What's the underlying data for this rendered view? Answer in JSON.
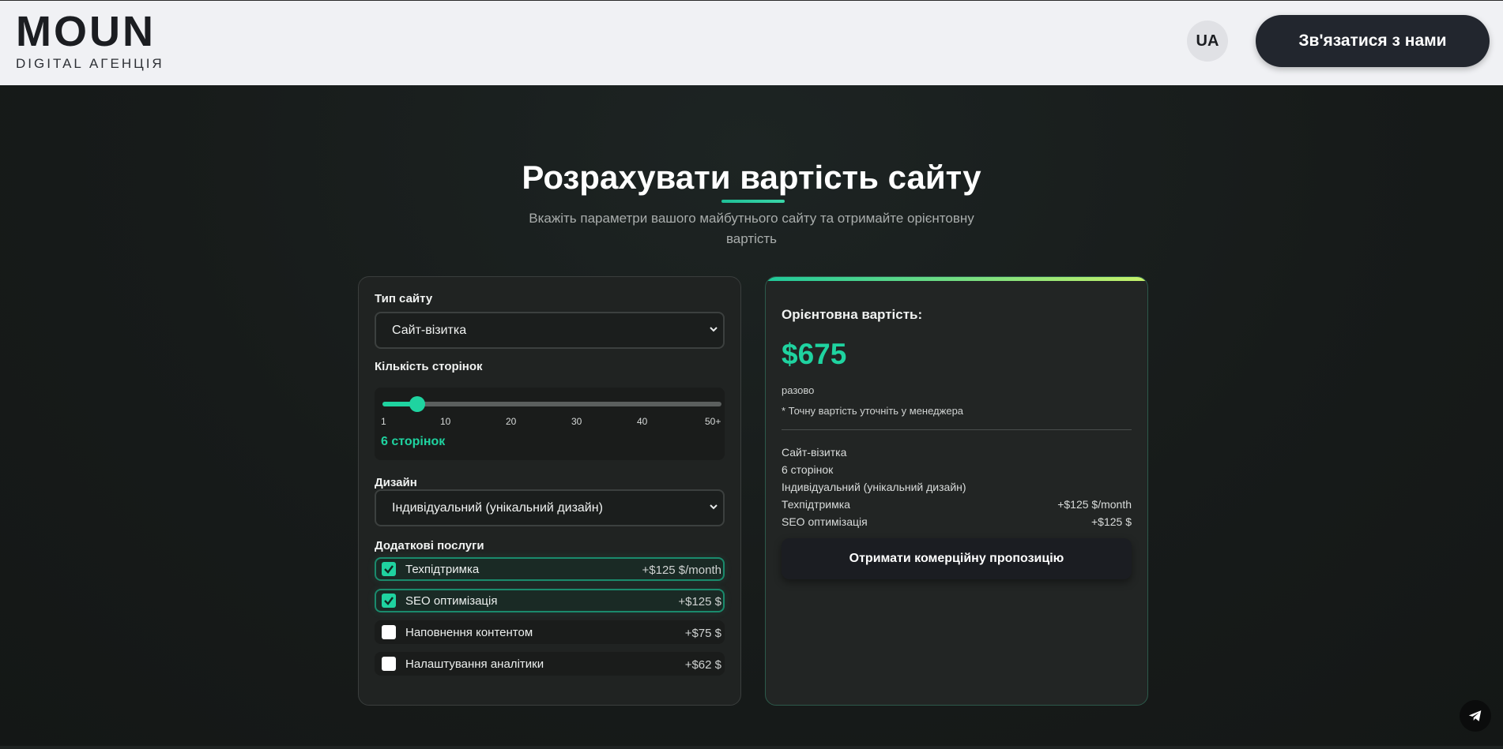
{
  "header": {
    "logo": "MOUN",
    "logo_subtitle": "DIGITAL АГЕНЦІЯ",
    "language": "UA",
    "contact_button": "Зв'язатися з нами"
  },
  "hero": {
    "title": "Розрахувати вартість сайту",
    "subtitle": "Вкажіть параметри вашого майбутнього сайту та отримайте орієнтовну вартість"
  },
  "calculator": {
    "site_type_label": "Тип сайту",
    "site_type_value": "Сайт-візитка",
    "pages_label": "Кількість сторінок",
    "pages_ticks": [
      "1",
      "10",
      "20",
      "30",
      "40",
      "50+"
    ],
    "pages_value": 6,
    "pages_min": 1,
    "pages_max": 50,
    "pages_text": "6 сторінок",
    "design_label": "Дизайн",
    "design_value": "Індивідуальний (унікальний дизайн)",
    "extras_label": "Додаткові послуги",
    "extras": [
      {
        "label": "Техпідтримка",
        "price": "+$125 $/month",
        "checked": true
      },
      {
        "label": "SEO оптимізація",
        "price": "+$125 $",
        "checked": true
      },
      {
        "label": "Наповнення контентом",
        "price": "+$75 $",
        "checked": false
      },
      {
        "label": "Налаштування аналітики",
        "price": "+$62 $",
        "checked": false
      }
    ]
  },
  "summary": {
    "label": "Орієнтовна вартість:",
    "price": "$675",
    "payment_type": "разово",
    "note": "* Точну вартість уточніть у менеджера",
    "rows": [
      {
        "name": "Сайт-візитка",
        "value": ""
      },
      {
        "name": "6 сторінок",
        "value": ""
      },
      {
        "name": "Індивідуальний (унікальний дизайн)",
        "value": ""
      },
      {
        "name": "Техпідтримка",
        "value": "+$125 $/month"
      },
      {
        "name": "SEO оптимізація",
        "value": "+$125 $"
      }
    ],
    "offer_button": "Отримати комерційну пропозицію"
  },
  "colors": {
    "accent": "#1fd3a0",
    "header_bg": "#f0f1f4",
    "page_bg": "#161a19"
  },
  "icons": {
    "telegram": "telegram-icon",
    "select_arrow": "chevron-down-icon",
    "checkbox_check": "check-icon"
  }
}
